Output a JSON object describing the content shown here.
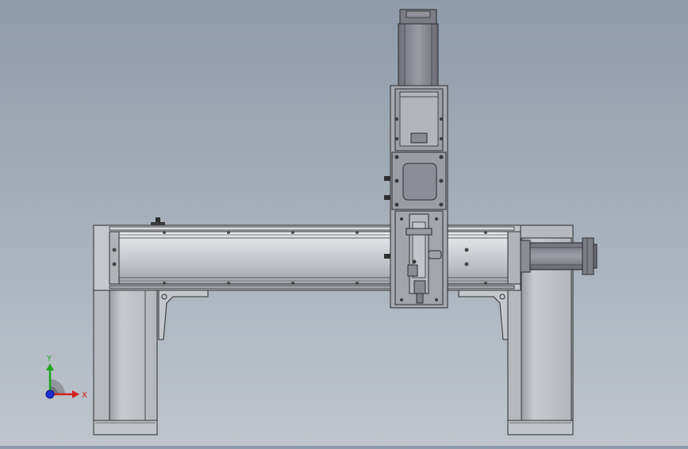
{
  "viewport": {
    "background_top": "#8e9bab",
    "background_bottom": "#bfc5cb"
  },
  "triad": {
    "x_label": "X",
    "y_label": "Y",
    "x_color": "#d42020",
    "y_color": "#1fa51f",
    "z_color": "#1e2fd6"
  },
  "model": {
    "body_color": "#c9cdd2",
    "shadow_color": "#a6abb2",
    "edge_color": "#2b2b2b",
    "carriage_color": "#8e9099"
  }
}
